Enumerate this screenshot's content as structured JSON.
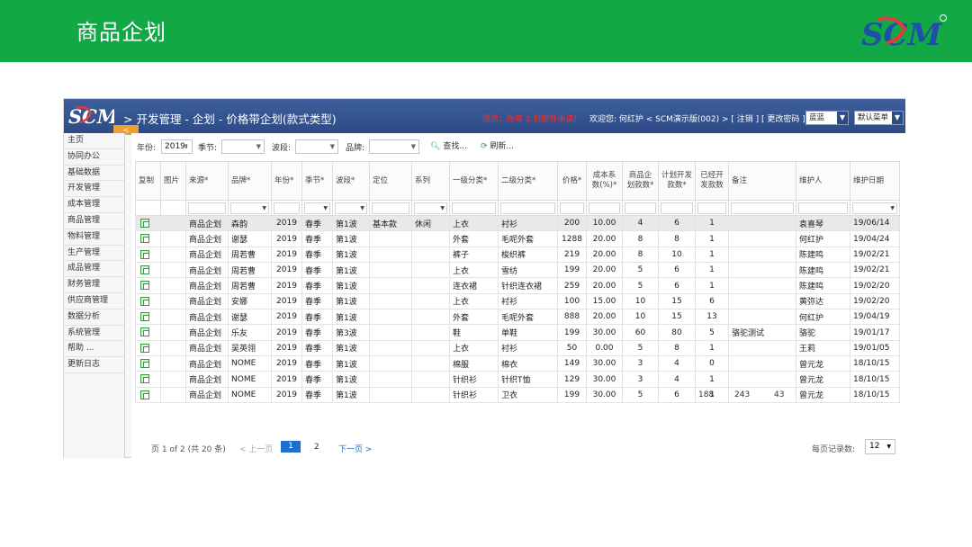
{
  "banner": {
    "title": "商品企划"
  },
  "app": {
    "breadcrumb": "> 开发管理 - 企划 - 价格带企划(款式类型)",
    "notice": "提示：你有 1 封邮件未读!",
    "welcome": "欢迎您: 何红护 < SCM演示版(002) > [ 注销 ] [ 更改密码 ]",
    "theme_select": "蓝蓝",
    "menu_select": "默认菜单",
    "collapse_icon": "chevron-left-icon"
  },
  "sidebar": {
    "items": [
      "主页",
      "协同办公",
      "基础数据",
      "开发管理",
      "成本管理",
      "商品管理",
      "物料管理",
      "生产管理",
      "成品管理",
      "财务管理",
      "供应商管理",
      "数据分析",
      "系统管理",
      "帮助 ...",
      "更新日志"
    ]
  },
  "filters": {
    "year_label": "年份:",
    "year_value": "2019",
    "season_label": "季节:",
    "wave_label": "波段:",
    "brand_label": "品牌:",
    "search_button": "查找...",
    "refresh_button": "刷新..."
  },
  "table": {
    "headers": [
      "复制",
      "图片",
      "来源*",
      "品牌*",
      "年份*",
      "季节*",
      "波段*",
      "定位",
      "系列",
      "一级分类*",
      "二级分类*",
      "价格*",
      "成本系数(%)*",
      "商品企划款数*",
      "计划开发款数*",
      "已经开发款数",
      "备注",
      "维护人",
      "维护日期"
    ],
    "rows": [
      [
        "",
        "",
        "商品企划",
        "森韵",
        "2019",
        "春季",
        "第1波",
        "基本款",
        "休闲",
        "上衣",
        "衬衫",
        "200",
        "10.00",
        "4",
        "6",
        "1",
        "",
        "袁喜琴",
        "19/06/14"
      ],
      [
        "",
        "",
        "商品企划",
        "谢瑟",
        "2019",
        "春季",
        "第1波",
        "",
        "",
        "外套",
        "毛呢外套",
        "1288",
        "20.00",
        "8",
        "8",
        "1",
        "",
        "何红护",
        "19/04/24"
      ],
      [
        "",
        "",
        "商品企划",
        "周若曹",
        "2019",
        "春季",
        "第1波",
        "",
        "",
        "裤子",
        "梭织裤",
        "219",
        "20.00",
        "8",
        "10",
        "1",
        "",
        "陈建鸣",
        "19/02/21"
      ],
      [
        "",
        "",
        "商品企划",
        "周若曹",
        "2019",
        "春季",
        "第1波",
        "",
        "",
        "上衣",
        "雪纺",
        "199",
        "20.00",
        "5",
        "6",
        "1",
        "",
        "陈建鸣",
        "19/02/21"
      ],
      [
        "",
        "",
        "商品企划",
        "周若曹",
        "2019",
        "春季",
        "第1波",
        "",
        "",
        "连衣裙",
        "针织连衣裙",
        "259",
        "20.00",
        "5",
        "6",
        "1",
        "",
        "陈建鸣",
        "19/02/20"
      ],
      [
        "",
        "",
        "商品企划",
        "安娜",
        "2019",
        "春季",
        "第1波",
        "",
        "",
        "上衣",
        "衬衫",
        "100",
        "15.00",
        "10",
        "15",
        "6",
        "",
        "黄弥达",
        "19/02/20"
      ],
      [
        "",
        "",
        "商品企划",
        "谢瑟",
        "2019",
        "春季",
        "第1波",
        "",
        "",
        "外套",
        "毛呢外套",
        "888",
        "20.00",
        "10",
        "15",
        "13",
        "",
        "何红护",
        "19/04/19"
      ],
      [
        "",
        "",
        "商品企划",
        "乐友",
        "2019",
        "春季",
        "第3波",
        "",
        "",
        "鞋",
        "单鞋",
        "199",
        "30.00",
        "60",
        "80",
        "5",
        "骆驼测试",
        "骆驼",
        "19/01/17"
      ],
      [
        "",
        "",
        "商品企划",
        "吴英翎",
        "2019",
        "春季",
        "第1波",
        "",
        "",
        "上衣",
        "衬衫",
        "50",
        "0.00",
        "5",
        "8",
        "1",
        "",
        "王莉",
        "19/01/05"
      ],
      [
        "",
        "",
        "商品企划",
        "NOME",
        "2019",
        "春季",
        "第1波",
        "",
        "",
        "棉服",
        "棉衣",
        "149",
        "30.00",
        "3",
        "4",
        "0",
        "",
        "曾元龙",
        "18/10/15"
      ],
      [
        "",
        "",
        "商品企划",
        "NOME",
        "2019",
        "春季",
        "第1波",
        "",
        "",
        "针织衫",
        "针织T恤",
        "129",
        "30.00",
        "3",
        "4",
        "1",
        "",
        "曾元龙",
        "18/10/15"
      ],
      [
        "",
        "",
        "商品企划",
        "NOME",
        "2019",
        "春季",
        "第1波",
        "",
        "",
        "针织衫",
        "卫衣",
        "199",
        "30.00",
        "5",
        "6",
        "1",
        "",
        "曾元龙",
        "18/10/15"
      ]
    ],
    "totals": {
      "planned": "188",
      "dev_plan": "243",
      "developed": "43"
    }
  },
  "pager": {
    "info": "页 1 of 2 (共 20 条)",
    "prev": "< 上一页",
    "current": "1",
    "page2": "2",
    "next": "下一页 >",
    "per_page_label": "每页记录数:",
    "per_page_value": "12"
  },
  "colors": {
    "banner": "#11a845",
    "topbar": "#2d4b86",
    "accent": "#1d6fd0",
    "notice": "#ff2b2b"
  }
}
